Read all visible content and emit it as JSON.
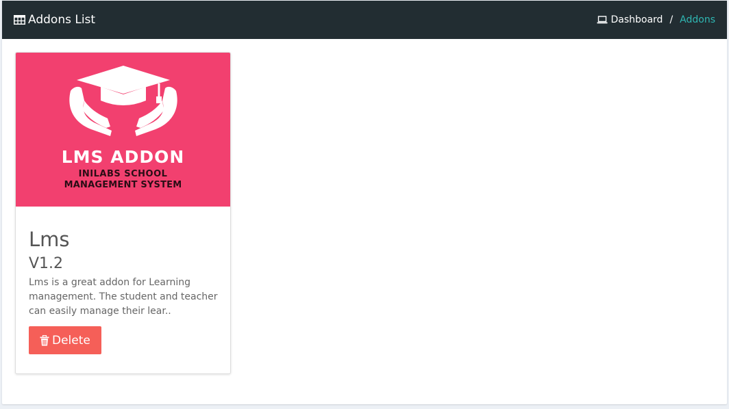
{
  "header": {
    "title": "Addons List",
    "title_icon": "table-icon"
  },
  "breadcrumb": {
    "dashboard_label": "Dashboard",
    "dashboard_icon": "laptop-icon",
    "separator": "/",
    "current_label": "Addons"
  },
  "addon": {
    "image": {
      "title": "LMS ADDON",
      "subtitle_line1": "INILABS SCHOOL",
      "subtitle_line2": "MANAGEMENT SYSTEM",
      "icon": "graduation-cap-hands-icon",
      "background_color": "#f2406f"
    },
    "name": "Lms",
    "version": "V1.2",
    "description": "Lms is a great addon for Learning management. The student and teacher can easily manage their lear..",
    "delete_label": "Delete",
    "delete_icon": "trash-icon"
  },
  "colors": {
    "header_bg": "#222d32",
    "breadcrumb_active": "#2fb7b3",
    "delete_button": "#f55f58"
  }
}
